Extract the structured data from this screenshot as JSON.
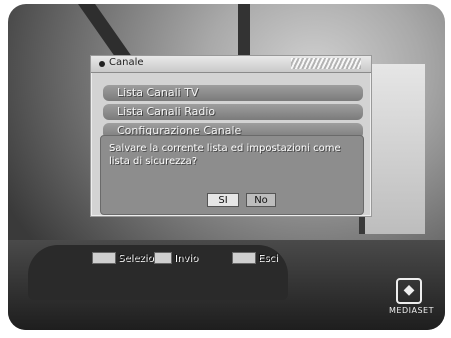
{
  "panel": {
    "title": "Canale",
    "items": [
      {
        "label": "Lista Canali TV"
      },
      {
        "label": "Lista Canali Radio"
      },
      {
        "label": "Configurazione Canale"
      }
    ]
  },
  "dialog": {
    "message": "Salvare la corrente lista ed impostazioni come lista di sicurezza?",
    "yes_label": "SI",
    "no_label": "No"
  },
  "footer": {
    "select_label": "Selezion",
    "send_label": "Invio",
    "exit_label": "Esci"
  },
  "logo": {
    "text": "MEDIASET"
  }
}
